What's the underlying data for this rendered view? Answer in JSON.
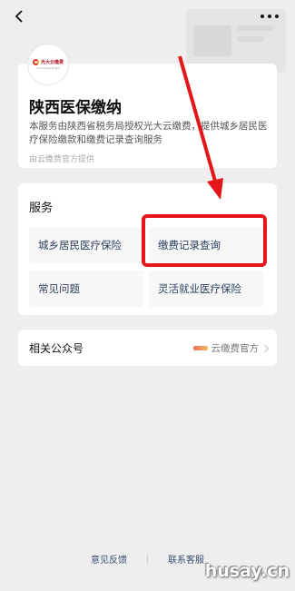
{
  "nav": {
    "back_icon": "back-chevron-icon",
    "more_icon": "more-dots-icon"
  },
  "info": {
    "logo_brand": "光大云缴费",
    "logo_sub": "China Everbright",
    "title": "陕西医保缴纳",
    "description": "本服务由陕西省税务局授权光大云缴费，提供城乡居民医疗保险缴款和缴费记录查询服务",
    "provider": "由云缴费官方提供"
  },
  "services": {
    "heading": "服务",
    "items": [
      {
        "label": "城乡居民医疗保险"
      },
      {
        "label": "缴费记录查询"
      },
      {
        "label": "常见问题"
      },
      {
        "label": "灵活就业医疗保险"
      }
    ]
  },
  "related": {
    "label": "相关公众号",
    "account": "云缴费官方"
  },
  "footer": {
    "feedback": "意见反馈",
    "service": "联系客服"
  },
  "watermark": "husay.cn",
  "colors": {
    "highlight": "#e4161a",
    "link": "#3d4f73"
  }
}
